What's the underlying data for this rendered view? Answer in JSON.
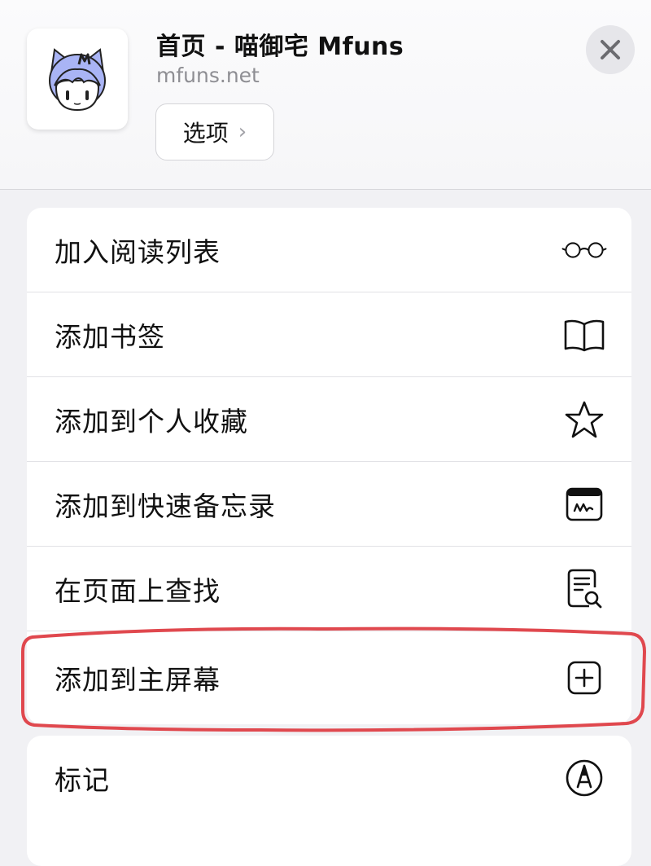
{
  "header": {
    "title": "首页 - 喵御宅 Mfuns",
    "url": "mfuns.net",
    "options_label": "选项",
    "options_chevron": "›",
    "app_icon": "mfuns-cat-avatar",
    "close_icon": "close-icon"
  },
  "menu": [
    {
      "label": "加入阅读列表",
      "icon": "glasses-icon"
    },
    {
      "label": "添加书签",
      "icon": "book-icon"
    },
    {
      "label": "添加到个人收藏",
      "icon": "star-icon"
    },
    {
      "label": "添加到快速备忘录",
      "icon": "quick-note-icon"
    },
    {
      "label": "在页面上查找",
      "icon": "find-on-page-icon"
    },
    {
      "label": "添加到主屏幕",
      "icon": "add-square-icon",
      "highlighted": true
    }
  ],
  "menu2": [
    {
      "label": "标记",
      "icon": "markup-pen-icon"
    }
  ],
  "colors": {
    "annotation_stroke": "#e0484e",
    "background": "#f1f1f4"
  }
}
